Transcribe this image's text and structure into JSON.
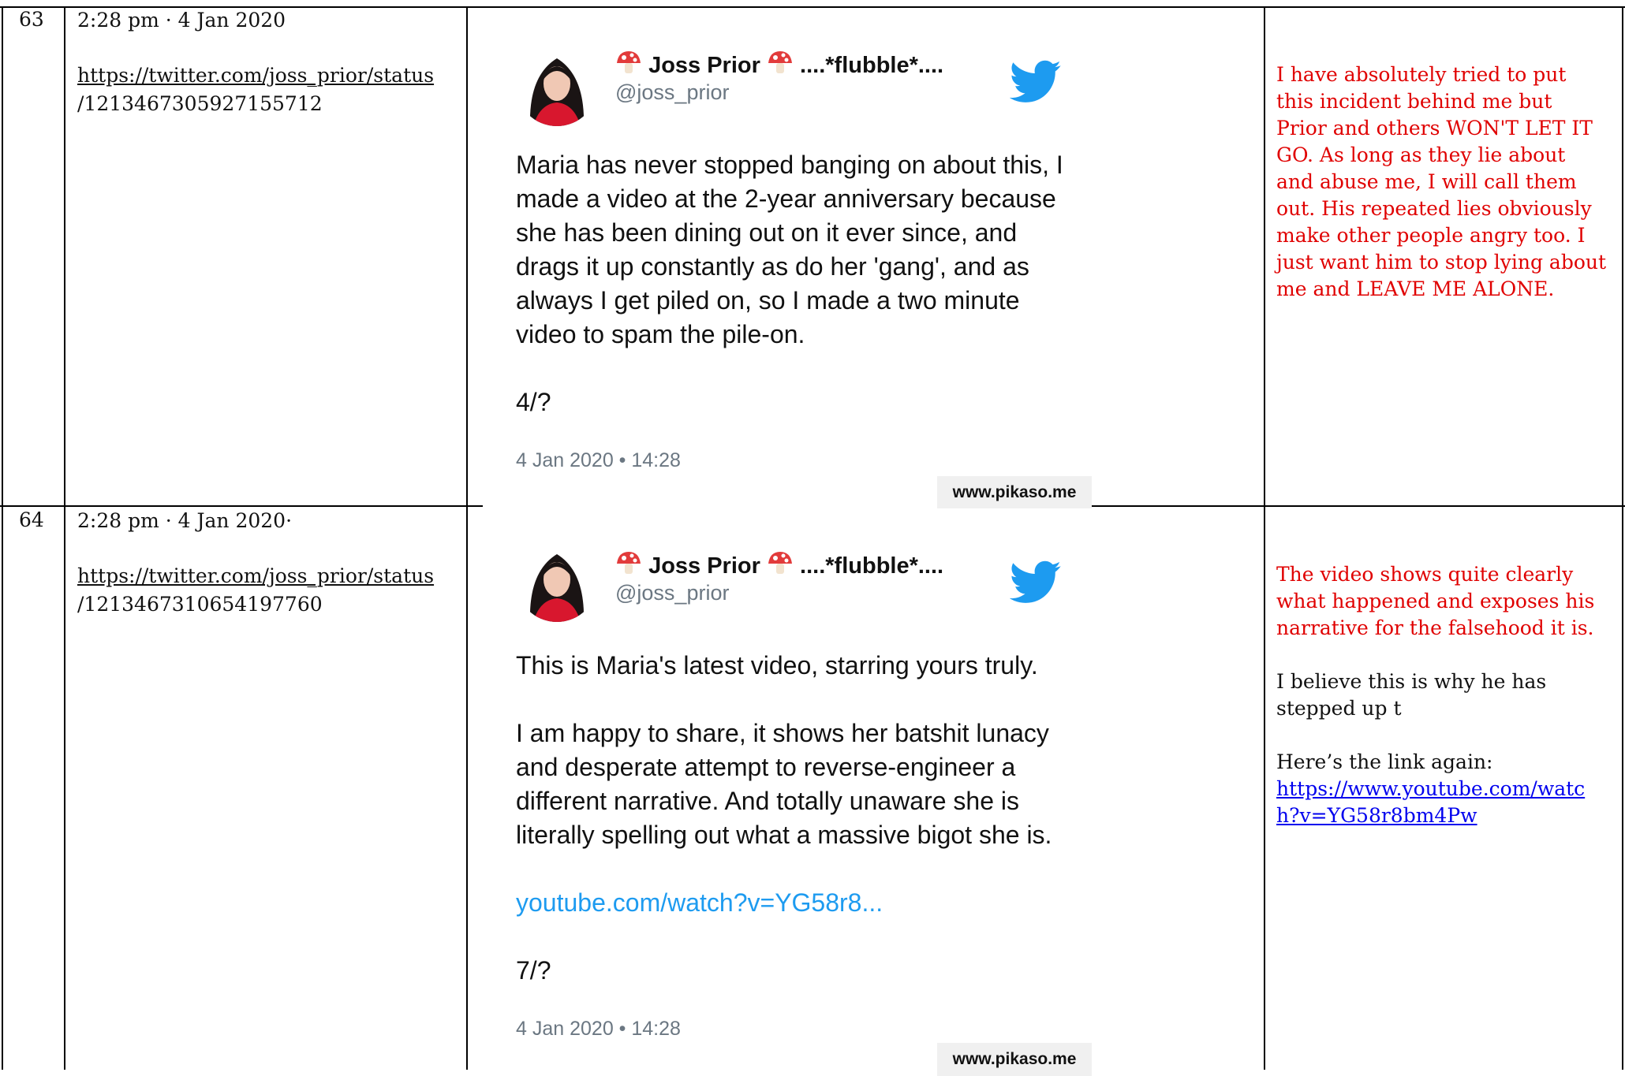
{
  "rows": [
    {
      "number": "63",
      "timestamp": "2:28 pm · 4 Jan 2020",
      "url_line1": "https://twitter.com/joss_prior/status",
      "url_line2": "/1213467305927155712",
      "tweet": {
        "name": "Joss Prior",
        "name_suffix": "....*flubble*....",
        "handle": "@joss_prior",
        "paragraphs": [
          "Maria has never stopped banging on about this, I made a video at the 2-year anniversary because she has been dining out on it ever since, and drags it up constantly as do her 'gang', and as always I get piled on, so I made a two minute video to spam the pile-on.",
          "4/?"
        ],
        "date": "4 Jan 2020 • 14:28",
        "watermark": "www.pikaso.me"
      },
      "comment": "I have absolutely tried to put this incident behind me but Prior and others WON'T LET IT GO. As long as they lie about and abuse me, I will call them out. His repeated lies obviously make other people angry too. I just want him to stop lying about me and LEAVE ME ALONE."
    },
    {
      "number": "64",
      "timestamp": "2:28 pm · 4 Jan 2020·",
      "url_line1": "https://twitter.com/joss_prior/status",
      "url_line2": "/1213467310654197760",
      "tweet": {
        "name": "Joss Prior",
        "name_suffix": "....*flubble*....",
        "handle": "@joss_prior",
        "paragraphs": [
          "This is Maria's latest video, starring yours truly.",
          "I am happy to share, it shows her batshit lunacy and desperate attempt to reverse-engineer a different narrative. And totally unaware she is literally spelling out what a massive bigot she is."
        ],
        "link": "youtube.com/watch?v=YG58r8...",
        "tail": "7/?",
        "date": "4 Jan 2020 • 14:28",
        "watermark": "www.pikaso.me"
      },
      "comment_red": "The video shows quite clearly what happened and exposes his narrative for the falsehood it is.",
      "comment_black": "I believe this is why he has stepped up t",
      "comment_link_label": "Here’s the link again:",
      "comment_link": "https://www.youtube.com/watch?v=YG58r8bm4Pw",
      "comment_link_line1": "https://www.youtube.com/watc",
      "comment_link_line2": "h?v=YG58r8bm4Pw"
    }
  ],
  "colors": {
    "annotation": "#e00000",
    "link": "#0000ee",
    "tweet_link": "#1d9bf0",
    "twitter_bird": "#1d9bf0"
  },
  "icons": [
    "mushroom-icon",
    "twitter-bird-icon",
    "avatar"
  ]
}
